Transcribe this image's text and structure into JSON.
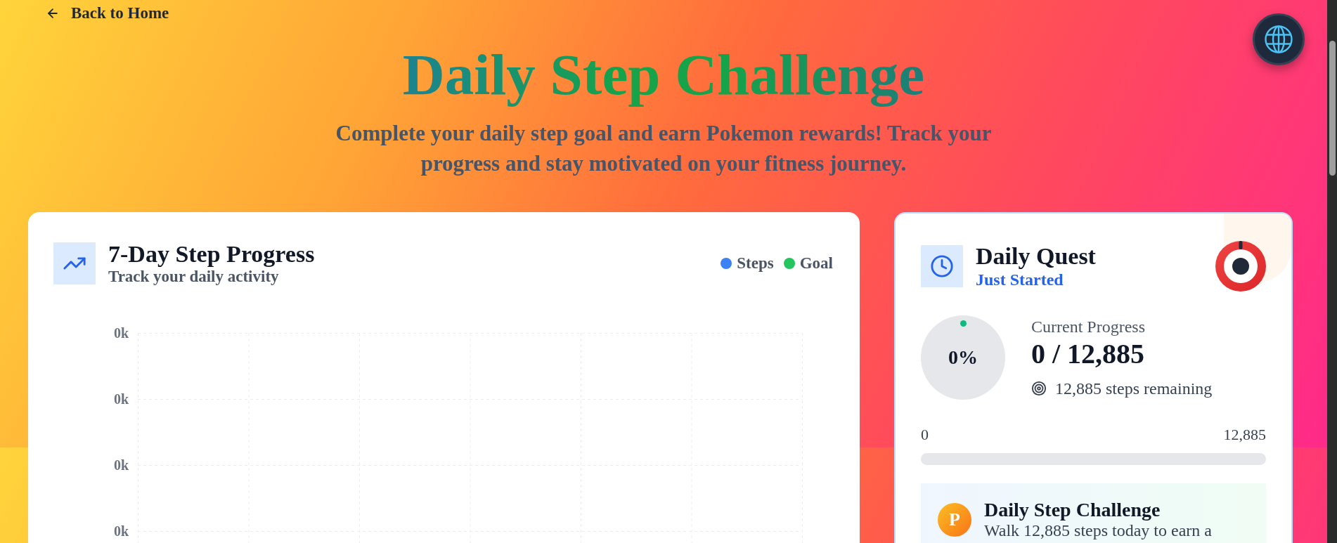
{
  "nav": {
    "back_link": "Back to Home"
  },
  "header": {
    "title": "Daily Step Challenge",
    "subtitle": "Complete your daily step goal and earn Pokemon rewards! Track your progress and stay motivated on your fitness journey."
  },
  "progress_card": {
    "title": "7-Day Step Progress",
    "subtitle": "Track your daily activity",
    "legend": [
      {
        "label": "Steps",
        "color": "#3b82f6"
      },
      {
        "label": "Goal",
        "color": "#22c55e"
      }
    ],
    "y_axis_labels": [
      "0k",
      "0k",
      "0k",
      "0k"
    ]
  },
  "quest_card": {
    "title": "Daily Quest",
    "status": "Just Started",
    "ring": {
      "label": "0%"
    },
    "current_label": "Current Progress",
    "current_value": "0 / 12,885",
    "remaining": "12,885 steps remaining",
    "bar": {
      "min_label": "0",
      "max_label": "12,885"
    },
    "reward": {
      "badge": "P",
      "title": "Daily Step Challenge",
      "description": "Walk 12,885 steps today to earn a"
    }
  }
}
